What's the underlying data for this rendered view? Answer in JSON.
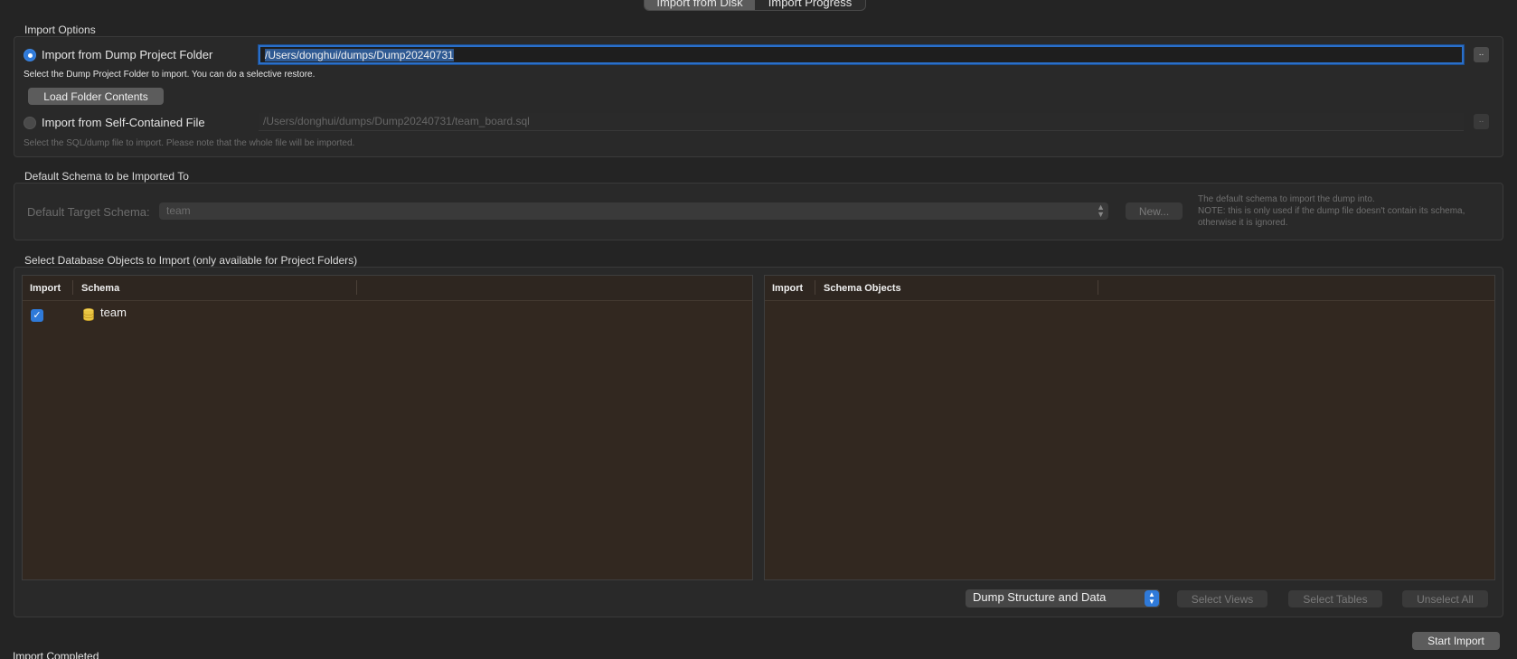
{
  "tabs": [
    {
      "label": "Import from Disk",
      "active": true
    },
    {
      "label": "Import Progress",
      "active": false
    }
  ],
  "import_options": {
    "title": "Import Options",
    "folder_option_label": "Import from Dump Project Folder",
    "folder_path": "/Users/donghui/dumps/Dump20240731",
    "browse_label": "..",
    "folder_hint": "Select the Dump Project Folder to import. You can do a selective restore.",
    "load_button": "Load Folder Contents",
    "file_option_label": "Import from Self-Contained File",
    "file_path": "/Users/donghui/dumps/Dump20240731/team_board.sql",
    "file_hint": "Select the SQL/dump file to import. Please note that the whole file will be imported."
  },
  "default_schema": {
    "title": "Default Schema to be Imported To",
    "label": "Default Target Schema:",
    "value": "team",
    "new_button": "New...",
    "note_lines": [
      "The default schema to import the dump into.",
      "NOTE: this is only used if the dump file doesn't contain its schema,",
      "otherwise it is ignored."
    ]
  },
  "objects": {
    "title": "Select Database Objects to Import (only available for Project Folders)",
    "left_table": {
      "headers": [
        "Import",
        "Schema"
      ],
      "rows": [
        {
          "checked": true,
          "icon": "database-icon",
          "name": "team"
        }
      ]
    },
    "right_table": {
      "headers": [
        "Import",
        "Schema Objects"
      ],
      "rows": []
    },
    "dump_mode": "Dump Structure and Data",
    "select_views": "Select Views",
    "select_tables": "Select Tables",
    "unselect_all": "Unselect All"
  },
  "footer": {
    "status": "Import Completed",
    "start_button": "Start Import"
  },
  "colors": {
    "accent": "#2f7ad9",
    "background": "#242424",
    "table_bg": "#322820"
  }
}
